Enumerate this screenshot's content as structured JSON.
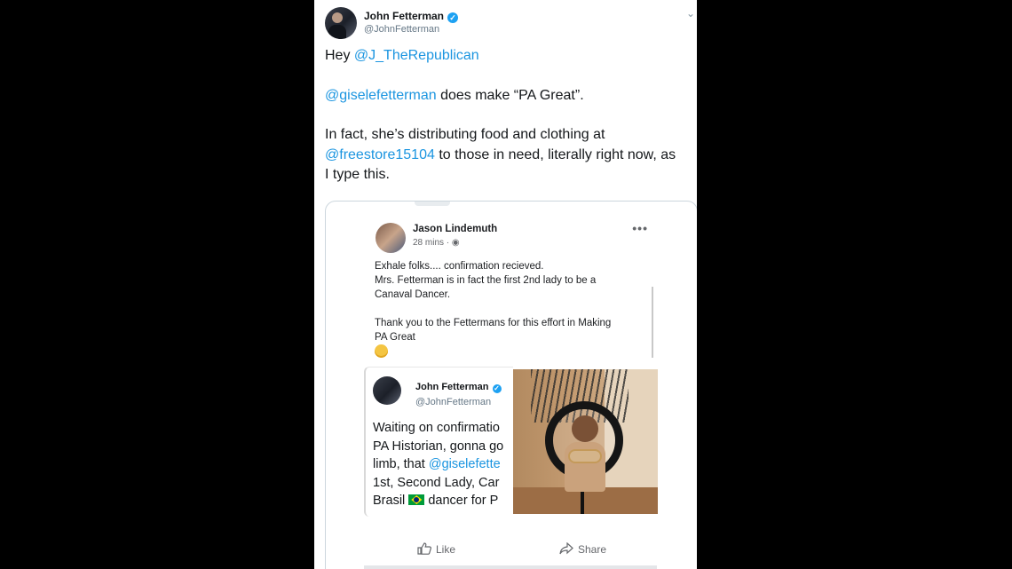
{
  "tweet": {
    "author_name": "John Fetterman",
    "handle": "@JohnFetterman",
    "line1_prefix": "Hey ",
    "line1_mention": "@J_TheRepublican",
    "line2_mention": "@giselefetterman",
    "line2_rest": " does make “PA Great”.",
    "line3_text": "In fact, she’s distributing food and clothing at",
    "line4_mention": "@freestore15104",
    "line4_rest": " to those in need, literally right now, as",
    "line5_text": "I type this."
  },
  "fb_post": {
    "author_name": "Jason Lindemuth",
    "meta": "28 mins ·",
    "line1": "Exhale folks.... confirmation recieved.",
    "line2": "Mrs. Fetterman is in fact the first 2nd lady to be a",
    "line3": "Canaval Dancer.",
    "line4": "Thank you to the Fettermans for this effort in Making",
    "line5": "PA Great",
    "like_label": "Like",
    "share_label": "Share"
  },
  "embedded_tweet": {
    "author_name": "John Fetterman",
    "handle": "@JohnFetterman",
    "line1": "Waiting on confirmatio",
    "line2": "PA Historian, gonna go",
    "line3_prefix": "limb, that ",
    "line3_mention": "@giselefette",
    "line4": "1st,  Second Lady, Car",
    "line5_prefix": "Brasil ",
    "line5_rest": " dancer for P"
  },
  "colors": {
    "mention": "#1b95e0",
    "verified": "#1da1f2",
    "background": "#000000"
  }
}
